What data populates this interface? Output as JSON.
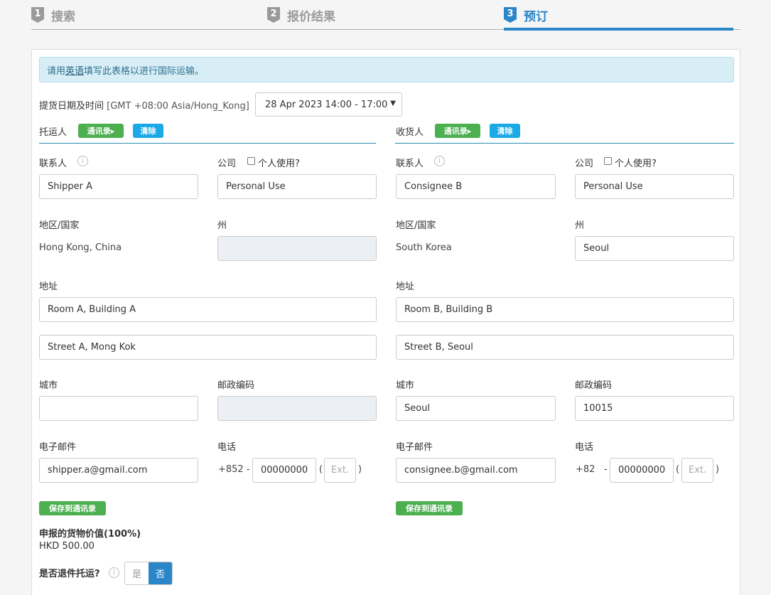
{
  "steps": [
    {
      "num": "1",
      "label": "搜索"
    },
    {
      "num": "2",
      "label": "报价结果"
    },
    {
      "num": "3",
      "label": "预订"
    }
  ],
  "notice": {
    "prefix": "请用",
    "link": "英语",
    "suffix": "填写此表格以进行国际运输。"
  },
  "pickup": {
    "label": "提货日期及时间",
    "timezone": "[GMT +08:00 Asia/Hong_Kong]",
    "selected": "28 Apr 2023 14:00 - 17:00"
  },
  "shipper": {
    "title": "托运人",
    "address_book_btn": "通讯录",
    "clear_btn": "清除",
    "contact_label": "联系人",
    "contact": "Shipper A",
    "company_label": "公司",
    "personal_label": "个人使用?",
    "company": "Personal Use",
    "country_label": "地区/国家",
    "country": "Hong Kong, China",
    "state_label": "州",
    "state": "",
    "address_label": "地址",
    "address1": "Room A, Building A",
    "address2": "Street A, Mong Kok",
    "city_label": "城市",
    "city": "",
    "postcode_label": "邮政编码",
    "postcode": "",
    "email_label": "电子邮件",
    "email": "shipper.a@gmail.com",
    "phone_label": "电话",
    "phone_code": "+852",
    "phone": "00000000",
    "ext_placeholder": "Ext.",
    "save_btn": "保存到通讯录"
  },
  "consignee": {
    "title": "收货人",
    "address_book_btn": "通讯录",
    "clear_btn": "清除",
    "contact_label": "联系人",
    "contact": "Consignee B",
    "company_label": "公司",
    "personal_label": "个人使用?",
    "company": "Personal Use",
    "country_label": "地区/国家",
    "country": "South Korea",
    "state_label": "州",
    "state": "Seoul",
    "address_label": "地址",
    "address1": "Room B, Building B",
    "address2": "Street B, Seoul",
    "city_label": "城市",
    "city": "Seoul",
    "postcode_label": "邮政编码",
    "postcode": "10015",
    "email_label": "电子邮件",
    "email": "consignee.b@gmail.com",
    "phone_label": "电话",
    "phone_code": "+82",
    "phone": "00000000",
    "ext_placeholder": "Ext.",
    "save_btn": "保存到通讯录"
  },
  "declared": {
    "label": "申报的货物价值(100%)",
    "value": "HKD 500.00"
  },
  "return_shipment": {
    "label": "是否退件托运?",
    "yes": "是",
    "no": "否",
    "selected": "否"
  },
  "colors": {
    "accent": "#2b86c8",
    "green": "#4caf50",
    "blue_btn": "#1ba8e6",
    "notice_bg": "#d8eef7"
  },
  "icons": [
    "info-icon",
    "caret-right-icon",
    "chevron-down-icon"
  ]
}
